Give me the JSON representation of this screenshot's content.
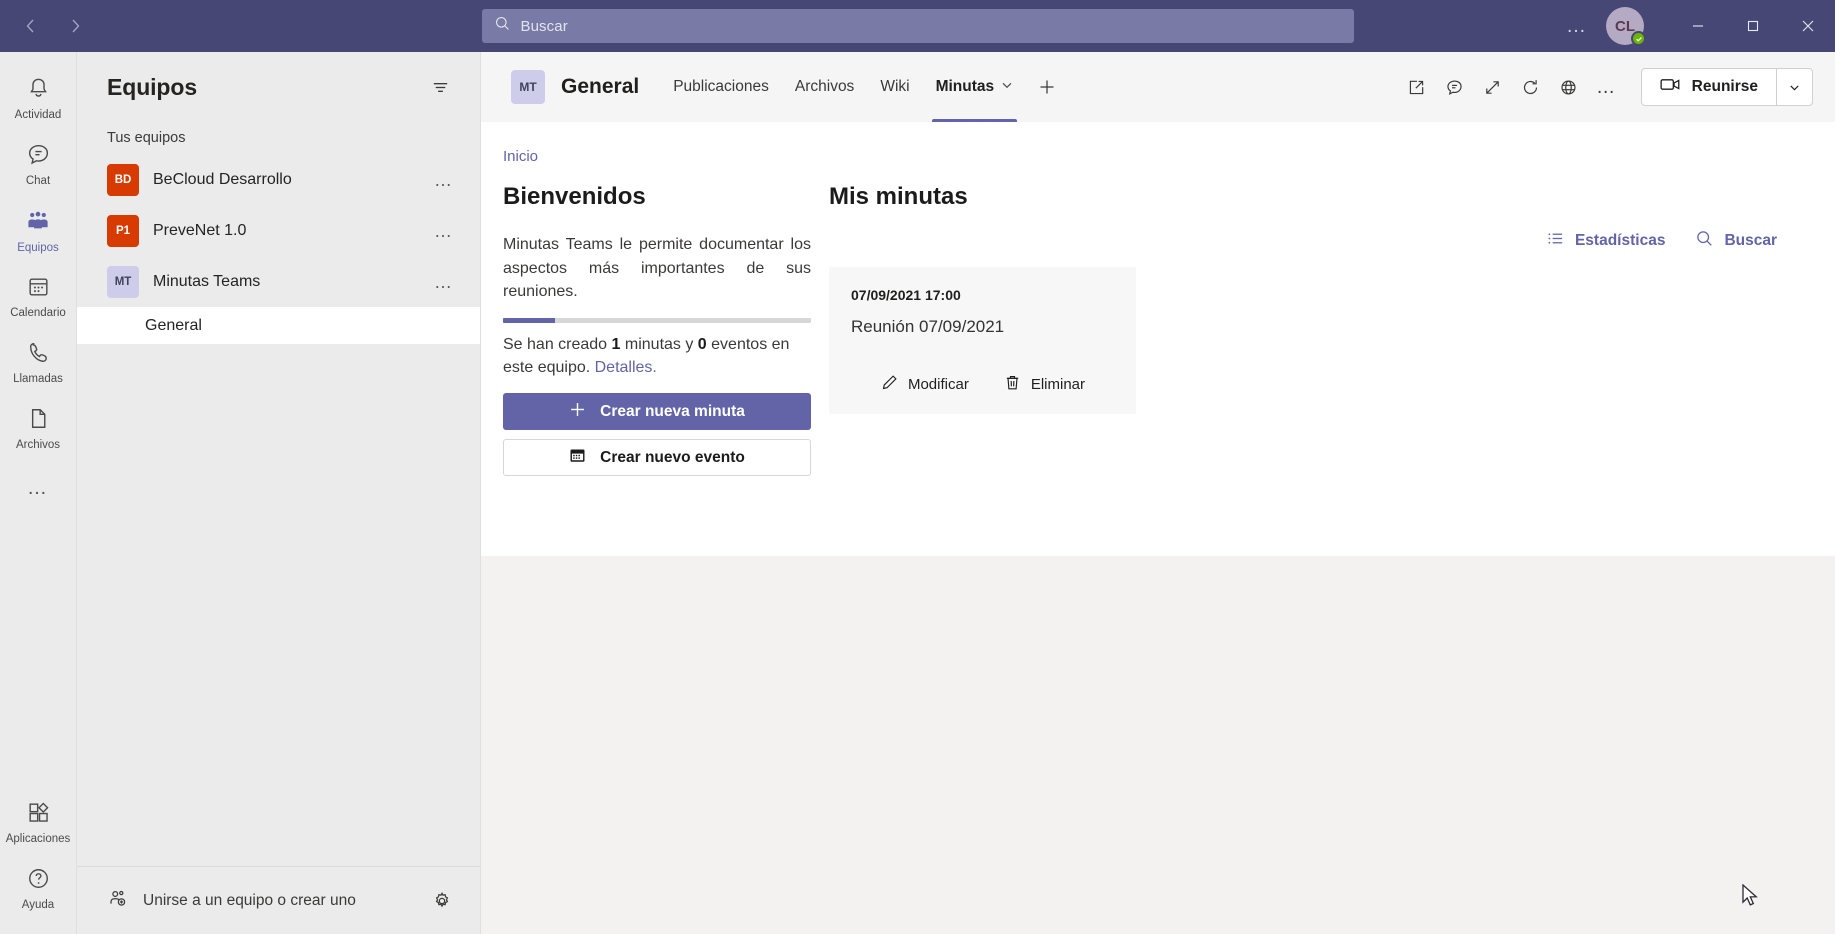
{
  "titlebar": {
    "back_label": "Atrás",
    "forward_label": "Adelante",
    "search_placeholder": "Buscar",
    "more_label": "…",
    "avatar_initials": "CL",
    "minimize_label": "Minimizar",
    "maximize_label": "Maximizar",
    "close_label": "Cerrar"
  },
  "rail": {
    "items": [
      {
        "label": "Actividad",
        "icon": "bell-icon",
        "active": false
      },
      {
        "label": "Chat",
        "icon": "chat-icon",
        "active": false
      },
      {
        "label": "Equipos",
        "icon": "teams-icon",
        "active": true
      },
      {
        "label": "Calendario",
        "icon": "calendar-icon",
        "active": false
      },
      {
        "label": "Llamadas",
        "icon": "phone-icon",
        "active": false
      },
      {
        "label": "Archivos",
        "icon": "file-icon",
        "active": false
      }
    ],
    "more_label": "…",
    "bottom_items": [
      {
        "label": "Aplicaciones",
        "icon": "apps-icon"
      },
      {
        "label": "Ayuda",
        "icon": "help-icon"
      }
    ]
  },
  "teams_panel": {
    "header_title": "Equipos",
    "filter_label": "Filtrar",
    "section_label": "Tus equipos",
    "teams": [
      {
        "initials": "BD",
        "name": "BeCloud Desarrollo",
        "color": "#D83B01",
        "text_color": "#ffffff",
        "more": "…"
      },
      {
        "initials": "P1",
        "name": "PreveNet 1.0",
        "color": "#D83B01",
        "text_color": "#ffffff",
        "more": "…"
      },
      {
        "initials": "MT",
        "name": "Minutas Teams",
        "color": "#CDCDEB",
        "text_color": "#42425E",
        "more": "…"
      }
    ],
    "channels": [
      {
        "name": "General",
        "team": "Minutas Teams",
        "active": true
      }
    ],
    "footer_join_label": "Unirse a un equipo o crear uno",
    "footer_settings_label": "Administrar equipos"
  },
  "channel_header": {
    "team_initials": "MT",
    "channel_title": "General",
    "tabs": [
      {
        "label": "Publicaciones",
        "active": false,
        "has_caret": false
      },
      {
        "label": "Archivos",
        "active": false,
        "has_caret": false
      },
      {
        "label": "Wiki",
        "active": false,
        "has_caret": false
      },
      {
        "label": "Minutas",
        "active": true,
        "has_caret": true
      }
    ],
    "add_tab_label": "+",
    "actions": [
      {
        "name": "open-in-new-window-icon",
        "label": "Abrir en nueva ventana"
      },
      {
        "name": "conversation-icon",
        "label": "Conversación sobre la pestaña"
      },
      {
        "name": "expand-icon",
        "label": "Expandir"
      },
      {
        "name": "refresh-icon",
        "label": "Actualizar"
      },
      {
        "name": "globe-icon",
        "label": "Abrir en navegador"
      }
    ],
    "more_label": "…",
    "meet_label": "Reunirse",
    "meet_caret_label": "Opciones de reunión"
  },
  "content": {
    "breadcrumb": "Inicio",
    "welcome": {
      "title": "Bienvenidos",
      "description": "Minutas Teams le permite documentar los aspectos más importantes de sus reuniones.",
      "progress_percent": 17,
      "stats_prefix": "Se han creado ",
      "stats_minutes_count": "1",
      "stats_middle": " minutas y ",
      "stats_events_count": "0",
      "stats_suffix": " eventos en este equipo. ",
      "stats_link": "Detalles.",
      "primary_button": "Crear nueva minuta",
      "secondary_button": "Crear nuevo evento"
    },
    "minutes": {
      "title": "Mis minutas",
      "stats_link": "Estadísticas",
      "search_link": "Buscar",
      "cards": [
        {
          "datetime": "07/09/2021 17:00",
          "name": "Reunión 07/09/2021",
          "edit_label": "Modificar",
          "delete_label": "Eliminar"
        }
      ]
    }
  },
  "colors": {
    "titlebar": "#464775",
    "accent": "#6264A7",
    "rail_bg": "#EBEBEB",
    "panel_bg": "#FFFFFF",
    "card_bg": "#F7F7F7",
    "presence_online": "#6BB700",
    "team_orange": "#D83B01"
  }
}
